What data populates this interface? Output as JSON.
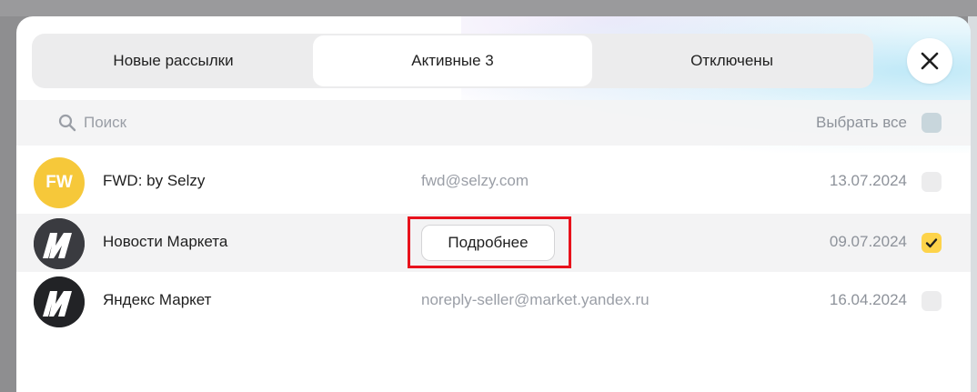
{
  "tabs": [
    {
      "label": "Новые рассылки",
      "active": false
    },
    {
      "label": "Активные 3",
      "active": true
    },
    {
      "label": "Отключены",
      "active": false
    }
  ],
  "search": {
    "placeholder": "Поиск",
    "icon": "search-icon"
  },
  "select_all": {
    "label": "Выбрать все",
    "checked": false
  },
  "subscriptions": [
    {
      "avatar_text": "FW",
      "avatar_color": "#f6c83a",
      "name": "FWD: by Selzy",
      "email": "fwd@selzy.com",
      "date": "13.07.2024",
      "checked": false
    },
    {
      "avatar_icon": "market-logo-icon",
      "name": "Новости Маркета",
      "email": "",
      "date": "09.07.2024",
      "checked": true,
      "action_label": "Подробнее"
    },
    {
      "avatar_icon": "market-logo-icon",
      "name": "Яндекс Маркет",
      "email": "noreply-seller@market.yandex.ru",
      "date": "16.04.2024",
      "checked": false
    }
  ],
  "colors": {
    "accent": "#fdd34a",
    "highlight": "#e8121c"
  }
}
